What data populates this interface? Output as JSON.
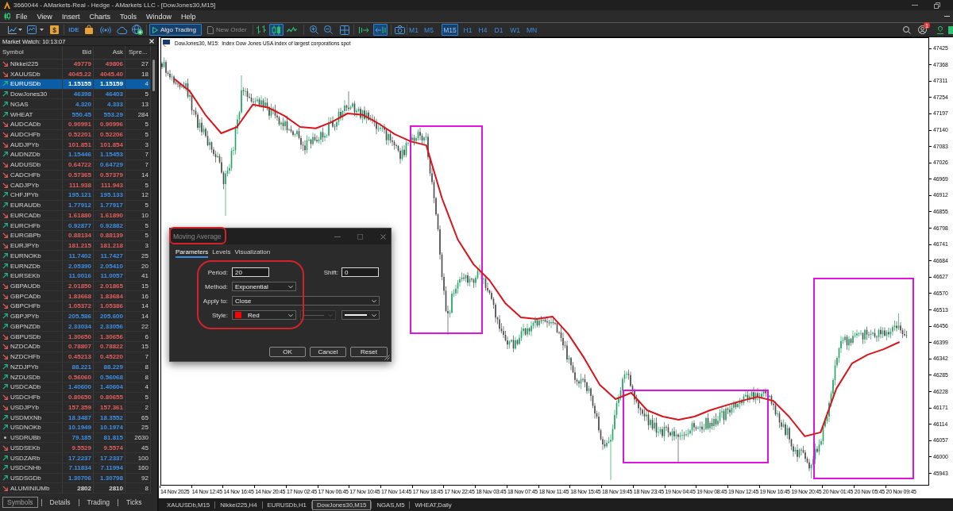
{
  "window": {
    "title": "3660044 - AMarkets-Real - Hedge - AMarkets LLC - [DowJones30,M15]"
  },
  "menu": [
    "File",
    "View",
    "Insert",
    "Charts",
    "Tools",
    "Window",
    "Help"
  ],
  "toolbar": {
    "dollar": "$",
    "ide": "IDE",
    "algo_trading": {
      "label": "Algo Trading",
      "on": true
    },
    "new_order": {
      "label": "New Order",
      "disabled": true
    },
    "chart_types": [
      {
        "kind": "bars",
        "selected": false
      },
      {
        "kind": "candles",
        "selected": true
      },
      {
        "kind": "line",
        "selected": false
      }
    ],
    "chart_toggles": [
      {
        "kind": "autoscroll",
        "on": false
      },
      {
        "kind": "chart-shift",
        "on": true
      }
    ],
    "timeframes": [
      {
        "label": "M1",
        "selected": false
      },
      {
        "label": "M5",
        "selected": false
      },
      {
        "label": "M15",
        "selected": true
      },
      {
        "label": "H1",
        "selected": false
      },
      {
        "label": "H4",
        "selected": false
      },
      {
        "label": "D1",
        "selected": false
      },
      {
        "label": "W1",
        "selected": false
      },
      {
        "label": "MN",
        "selected": false
      }
    ],
    "notifications": "1"
  },
  "market_watch": {
    "title": "Market Watch: 10:13:07",
    "columns": [
      "Symbol",
      "Bid",
      "Ask",
      "Spre..."
    ],
    "rows": [
      {
        "symbol": "Nikkei225",
        "kind": "down",
        "bid": {
          "value": "49779",
          "color": "#e25f5f"
        },
        "ask": {
          "value": "49806",
          "color": "#e25f5f"
        },
        "spread": "27",
        "selected": false
      },
      {
        "symbol": "XAUUSDb",
        "kind": "down",
        "bid": {
          "value": "4045.22",
          "color": "#e25f5f"
        },
        "ask": {
          "value": "4045.40",
          "color": "#e25f5f"
        },
        "spread": "18",
        "selected": false
      },
      {
        "symbol": "EURUSDb",
        "kind": "up",
        "bid": {
          "value": "1.15155"
        },
        "ask": {
          "value": "1.15159"
        },
        "spread": "4",
        "selected": true
      },
      {
        "symbol": "DowJones30",
        "kind": "up",
        "bid": {
          "value": "46398",
          "color": "#3f8fe6"
        },
        "ask": {
          "value": "46403",
          "color": "#3f8fe6"
        },
        "spread": "5",
        "selected": false
      },
      {
        "symbol": "NGAS",
        "kind": "up",
        "bid": {
          "value": "4.320",
          "color": "#3f8fe6"
        },
        "ask": {
          "value": "4.333",
          "color": "#3f8fe6"
        },
        "spread": "13",
        "selected": false
      },
      {
        "symbol": "WHEAT",
        "kind": "up",
        "bid": {
          "value": "550.45",
          "color": "#3f8fe6"
        },
        "ask": {
          "value": "553.29",
          "color": "#3f8fe6"
        },
        "spread": "284",
        "selected": false
      },
      {
        "symbol": "AUDCADb",
        "kind": "down",
        "bid": {
          "value": "0.90991",
          "color": "#e25f5f"
        },
        "ask": {
          "value": "0.90996",
          "color": "#e25f5f"
        },
        "spread": "5",
        "selected": false
      },
      {
        "symbol": "AUDCHFb",
        "kind": "down",
        "bid": {
          "value": "0.52201",
          "color": "#e25f5f"
        },
        "ask": {
          "value": "0.52206",
          "color": "#e25f5f"
        },
        "spread": "5",
        "selected": false
      },
      {
        "symbol": "AUDJPYb",
        "kind": "down",
        "bid": {
          "value": "101.851",
          "color": "#e25f5f"
        },
        "ask": {
          "value": "101.854",
          "color": "#e25f5f"
        },
        "spread": "3",
        "selected": false
      },
      {
        "symbol": "AUDNZDb",
        "kind": "up",
        "bid": {
          "value": "1.15446",
          "color": "#3f8fe6"
        },
        "ask": {
          "value": "1.15453",
          "color": "#3f8fe6"
        },
        "spread": "7",
        "selected": false
      },
      {
        "symbol": "AUDUSDb",
        "kind": "down",
        "bid": {
          "value": "0.64722",
          "color": "#e25f5f"
        },
        "ask": {
          "value": "0.64729",
          "color": "#3f8fe6"
        },
        "spread": "7",
        "selected": false
      },
      {
        "symbol": "CADCHFb",
        "kind": "down",
        "bid": {
          "value": "0.57365",
          "color": "#e25f5f"
        },
        "ask": {
          "value": "0.57379",
          "color": "#e25f5f"
        },
        "spread": "14",
        "selected": false
      },
      {
        "symbol": "CADJPYb",
        "kind": "down",
        "bid": {
          "value": "111.938",
          "color": "#e25f5f"
        },
        "ask": {
          "value": "111.943",
          "color": "#e25f5f"
        },
        "spread": "5",
        "selected": false
      },
      {
        "symbol": "CHFJPYb",
        "kind": "up",
        "bid": {
          "value": "195.121",
          "color": "#3f8fe6"
        },
        "ask": {
          "value": "195.133",
          "color": "#3f8fe6"
        },
        "spread": "12",
        "selected": false
      },
      {
        "symbol": "EURAUDb",
        "kind": "up",
        "bid": {
          "value": "1.77912",
          "color": "#3f8fe6"
        },
        "ask": {
          "value": "1.77917",
          "color": "#3f8fe6"
        },
        "spread": "5",
        "selected": false
      },
      {
        "symbol": "EURCADb",
        "kind": "down",
        "bid": {
          "value": "1.61880",
          "color": "#e25f5f"
        },
        "ask": {
          "value": "1.61890",
          "color": "#e25f5f"
        },
        "spread": "10",
        "selected": false
      },
      {
        "symbol": "EURCHFb",
        "kind": "up",
        "bid": {
          "value": "0.92877",
          "color": "#3f8fe6"
        },
        "ask": {
          "value": "0.92882",
          "color": "#3f8fe6"
        },
        "spread": "5",
        "selected": false
      },
      {
        "symbol": "EURGBPb",
        "kind": "down",
        "bid": {
          "value": "0.88134",
          "color": "#e25f5f"
        },
        "ask": {
          "value": "0.88139",
          "color": "#e25f5f"
        },
        "spread": "5",
        "selected": false
      },
      {
        "symbol": "EURJPYb",
        "kind": "down",
        "bid": {
          "value": "181.215",
          "color": "#e25f5f"
        },
        "ask": {
          "value": "181.218",
          "color": "#e25f5f"
        },
        "spread": "3",
        "selected": false
      },
      {
        "symbol": "EURNOKb",
        "kind": "up",
        "bid": {
          "value": "11.7402",
          "color": "#3f8fe6"
        },
        "ask": {
          "value": "11.7427",
          "color": "#3f8fe6"
        },
        "spread": "25",
        "selected": false
      },
      {
        "symbol": "EURNZDb",
        "kind": "up",
        "bid": {
          "value": "2.05390",
          "color": "#3f8fe6"
        },
        "ask": {
          "value": "2.05410",
          "color": "#3f8fe6"
        },
        "spread": "20",
        "selected": false
      },
      {
        "symbol": "EURSEKb",
        "kind": "up",
        "bid": {
          "value": "11.0016",
          "color": "#3f8fe6"
        },
        "ask": {
          "value": "11.0057",
          "color": "#3f8fe6"
        },
        "spread": "41",
        "selected": false
      },
      {
        "symbol": "GBPAUDb",
        "kind": "down",
        "bid": {
          "value": "2.01850",
          "color": "#e25f5f"
        },
        "ask": {
          "value": "2.01865",
          "color": "#e25f5f"
        },
        "spread": "15",
        "selected": false
      },
      {
        "symbol": "GBPCADb",
        "kind": "down",
        "bid": {
          "value": "1.83668",
          "color": "#e25f5f"
        },
        "ask": {
          "value": "1.83684",
          "color": "#e25f5f"
        },
        "spread": "16",
        "selected": false
      },
      {
        "symbol": "GBPCHFb",
        "kind": "down",
        "bid": {
          "value": "1.05372",
          "color": "#e25f5f"
        },
        "ask": {
          "value": "1.05386",
          "color": "#e25f5f"
        },
        "spread": "14",
        "selected": false
      },
      {
        "symbol": "GBPJPYb",
        "kind": "up",
        "bid": {
          "value": "205.586",
          "color": "#3f8fe6"
        },
        "ask": {
          "value": "205.600",
          "color": "#3f8fe6"
        },
        "spread": "14",
        "selected": false
      },
      {
        "symbol": "GBPNZDb",
        "kind": "up",
        "bid": {
          "value": "2.33034",
          "color": "#3f8fe6"
        },
        "ask": {
          "value": "2.33056",
          "color": "#3f8fe6"
        },
        "spread": "22",
        "selected": false
      },
      {
        "symbol": "GBPUSDb",
        "kind": "down",
        "bid": {
          "value": "1.30650",
          "color": "#e25f5f"
        },
        "ask": {
          "value": "1.30656",
          "color": "#e25f5f"
        },
        "spread": "6",
        "selected": false
      },
      {
        "symbol": "NZDCADb",
        "kind": "down",
        "bid": {
          "value": "0.78807",
          "color": "#e25f5f"
        },
        "ask": {
          "value": "0.78822",
          "color": "#e25f5f"
        },
        "spread": "15",
        "selected": false
      },
      {
        "symbol": "NZDCHFb",
        "kind": "down",
        "bid": {
          "value": "0.45213",
          "color": "#e25f5f"
        },
        "ask": {
          "value": "0.45220",
          "color": "#e25f5f"
        },
        "spread": "7",
        "selected": false
      },
      {
        "symbol": "NZDJPYb",
        "kind": "up",
        "bid": {
          "value": "88.221",
          "color": "#3f8fe6"
        },
        "ask": {
          "value": "88.229",
          "color": "#3f8fe6"
        },
        "spread": "8",
        "selected": false
      },
      {
        "symbol": "NZDUSDb",
        "kind": "up",
        "bid": {
          "value": "0.56060",
          "color": "#e25f5f"
        },
        "ask": {
          "value": "0.56068",
          "color": "#3f8fe6"
        },
        "spread": "8",
        "selected": false
      },
      {
        "symbol": "USDCADb",
        "kind": "up",
        "bid": {
          "value": "1.40600",
          "color": "#3f8fe6"
        },
        "ask": {
          "value": "1.40604",
          "color": "#3f8fe6"
        },
        "spread": "4",
        "selected": false
      },
      {
        "symbol": "USDCHFb",
        "kind": "down",
        "bid": {
          "value": "0.80650",
          "color": "#e25f5f"
        },
        "ask": {
          "value": "0.80655",
          "color": "#e25f5f"
        },
        "spread": "5",
        "selected": false
      },
      {
        "symbol": "USDJPYb",
        "kind": "down",
        "bid": {
          "value": "157.359",
          "color": "#e25f5f"
        },
        "ask": {
          "value": "157.361",
          "color": "#e25f5f"
        },
        "spread": "2",
        "selected": false
      },
      {
        "symbol": "USDMXNb",
        "kind": "up",
        "bid": {
          "value": "18.3487",
          "color": "#3f8fe6"
        },
        "ask": {
          "value": "18.3552",
          "color": "#3f8fe6"
        },
        "spread": "65",
        "selected": false
      },
      {
        "symbol": "USDNOKb",
        "kind": "up",
        "bid": {
          "value": "10.1949",
          "color": "#3f8fe6"
        },
        "ask": {
          "value": "10.1974",
          "color": "#3f8fe6"
        },
        "spread": "25",
        "selected": false
      },
      {
        "symbol": "USDRUBb",
        "kind": "flat",
        "bid": {
          "value": "79.185",
          "color": "#3f8fe6"
        },
        "ask": {
          "value": "81.815",
          "color": "#3f8fe6"
        },
        "spread": "2630",
        "selected": false
      },
      {
        "symbol": "USDSEKb",
        "kind": "down",
        "bid": {
          "value": "9.5529",
          "color": "#e25f5f"
        },
        "ask": {
          "value": "9.5574",
          "color": "#e25f5f"
        },
        "spread": "45",
        "selected": false
      },
      {
        "symbol": "USDZARb",
        "kind": "up",
        "bid": {
          "value": "17.2237",
          "color": "#3f8fe6"
        },
        "ask": {
          "value": "17.2337",
          "color": "#3f8fe6"
        },
        "spread": "100",
        "selected": false
      },
      {
        "symbol": "USDCNHb",
        "kind": "up",
        "bid": {
          "value": "7.11834",
          "color": "#3f8fe6"
        },
        "ask": {
          "value": "7.11994",
          "color": "#3f8fe6"
        },
        "spread": "160",
        "selected": false
      },
      {
        "symbol": "USDSGDb",
        "kind": "up",
        "bid": {
          "value": "1.30706",
          "color": "#3f8fe6"
        },
        "ask": {
          "value": "1.30798",
          "color": "#3f8fe6"
        },
        "spread": "92",
        "selected": false
      },
      {
        "symbol": "ALUMINIUMb",
        "kind": "down",
        "bid": {
          "value": "2802",
          "color": "#d8d8d8"
        },
        "ask": {
          "value": "2810",
          "color": "#d8d8d8"
        },
        "spread": "8",
        "selected": false
      }
    ],
    "tabs": [
      {
        "label": "Symbols",
        "selected": true
      },
      {
        "label": "Details",
        "selected": false
      },
      {
        "label": "Trading",
        "selected": false
      },
      {
        "label": "Ticks",
        "selected": false
      }
    ]
  },
  "chart": {
    "title": "DowJones30, M15:  Index Dow Jones USA index of largest corporations spot",
    "chart_data": {
      "type": "line",
      "categories": [
        "14 Nov 2025",
        null,
        "14 Nov 12:45",
        null,
        "14 Nov 16:45",
        null,
        "14 Nov 20:45",
        null,
        "17 Nov 02:45",
        null,
        "17 Nov 06:45",
        null,
        "17 Nov 10:45",
        null,
        "17 Nov 14:45",
        null,
        "17 Nov 18:45",
        null,
        "17 Nov 22:45",
        null,
        "18 Nov 03:45",
        null,
        "18 Nov 07:45",
        null,
        "18 Nov 11:45",
        null,
        "18 Nov 15:45",
        null,
        "18 Nov 19:45",
        null,
        "18 Nov 23:45",
        null,
        "19 Nov 04:45",
        null,
        "19 Nov 08:45",
        null,
        "19 Nov 12:45",
        null,
        "19 Nov 16:45",
        null,
        "19 Nov 20:45",
        null,
        "20 Nov 01:45",
        null,
        "20 Nov 05:45",
        null,
        "20 Nov 09:45",
        null
      ],
      "ylim": [
        45903,
        47461
      ],
      "yticks": [
        47425,
        47368,
        47311,
        47254,
        47197,
        47140,
        47083,
        47026,
        46969,
        46912,
        46855,
        46798,
        46741,
        46684,
        46627,
        46570,
        46513,
        46456,
        46399,
        46342,
        46285,
        46228,
        46171,
        46114,
        46057,
        46000,
        45943
      ],
      "series": [
        {
          "color": "#d8141c",
          "values": [
            47320,
            47276,
            47193,
            47129,
            47151,
            47229,
            47218,
            47190,
            47151,
            47146,
            47168,
            47198,
            47193,
            47162,
            47126,
            47101,
            47087,
            46902,
            46758,
            46672,
            46617,
            46537,
            46487,
            46481,
            46490,
            46429,
            46346,
            46252,
            46202,
            46224,
            46163,
            46141,
            46130,
            46141,
            46163,
            46180,
            46196,
            46210,
            46196,
            46141,
            46072,
            46086,
            46238,
            46327,
            46357,
            46376,
            46401,
            null
          ]
        }
      ]
    }
  },
  "chart_tabs": [
    {
      "label": "XAUUSDb,M15",
      "selected": false
    },
    {
      "label": "Nikkei225,H4",
      "selected": false
    },
    {
      "label": "EURUSDb,H1",
      "selected": false
    },
    {
      "label": "DowJones30,M15",
      "selected": true
    },
    {
      "label": "NGAS,M5",
      "selected": false
    },
    {
      "label": "WHEAT,Daily",
      "selected": false
    }
  ],
  "dialog": {
    "title": "Moving Average",
    "tabs": [
      {
        "label": "Parameters",
        "selected": true
      },
      {
        "label": "Levels",
        "selected": false
      },
      {
        "label": "Visualization",
        "selected": false
      }
    ],
    "rows": [
      [
        {
          "kind": "input",
          "label": "Period:",
          "value": "20"
        },
        {
          "kind": "input",
          "label": "Shift:",
          "value": "0"
        }
      ],
      [
        {
          "kind": "select",
          "label": "Method:",
          "value": "Exponential"
        }
      ],
      [
        {
          "kind": "select",
          "label": "Apply to:",
          "value": "Close"
        }
      ],
      [
        {
          "kind": "color-select",
          "label": "Style:",
          "value": "Red",
          "color": "#ff0000"
        },
        {
          "kind": "width-select",
          "disabled": true
        },
        {
          "kind": "line-select",
          "disabled": false
        }
      ]
    ],
    "buttons": [
      "OK",
      "Cancel",
      "Reset"
    ]
  }
}
